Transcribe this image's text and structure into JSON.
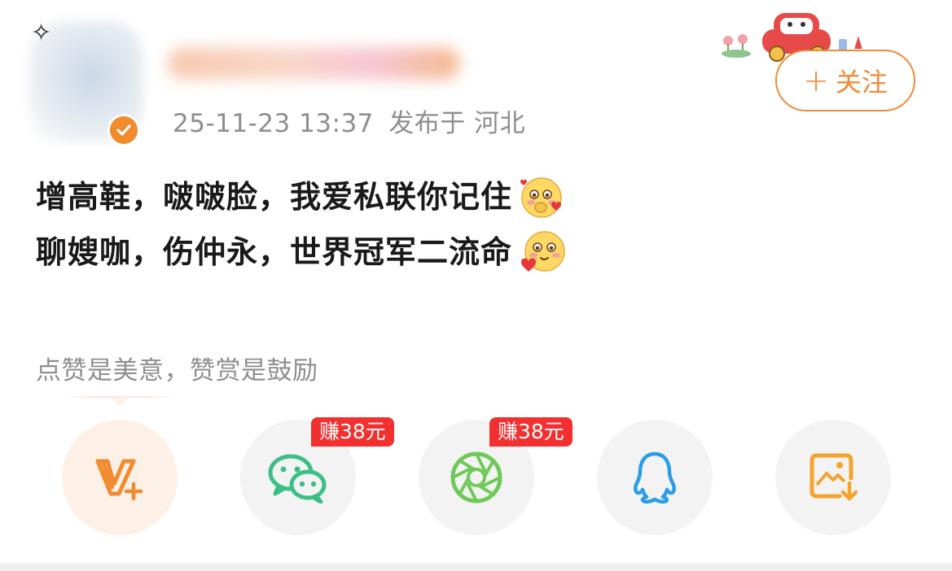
{
  "post_header": {
    "timestamp": "25-11-23 13:37",
    "published_at": "发布于 河北",
    "follow_label": "关注",
    "follow_plus": "+"
  },
  "post_body": {
    "line1": "增高鞋，啵啵脸，我爱私联你记住",
    "line2": "聊嫂咖，伤仲永，世界冠军二流命"
  },
  "reward_hint": "点赞是美意，赞赏是鼓励",
  "share_actions": [
    {
      "name": "v-plus",
      "icon": "v-plus-icon",
      "color": "#f28a2e"
    },
    {
      "name": "wechat",
      "icon": "wechat-icon",
      "color": "#3cbf86",
      "badge": "赚38元"
    },
    {
      "name": "moments",
      "icon": "moments-icon",
      "color": "#6fc95a",
      "badge": "赚38元"
    },
    {
      "name": "qq",
      "icon": "qq-icon",
      "color": "#2a9ee6"
    },
    {
      "name": "save-image",
      "icon": "save-image-icon",
      "color": "#f3a32e"
    }
  ],
  "colors": {
    "accent": "#f08a36",
    "badge": "#f2302f",
    "muted_text": "#8e8e8e"
  }
}
